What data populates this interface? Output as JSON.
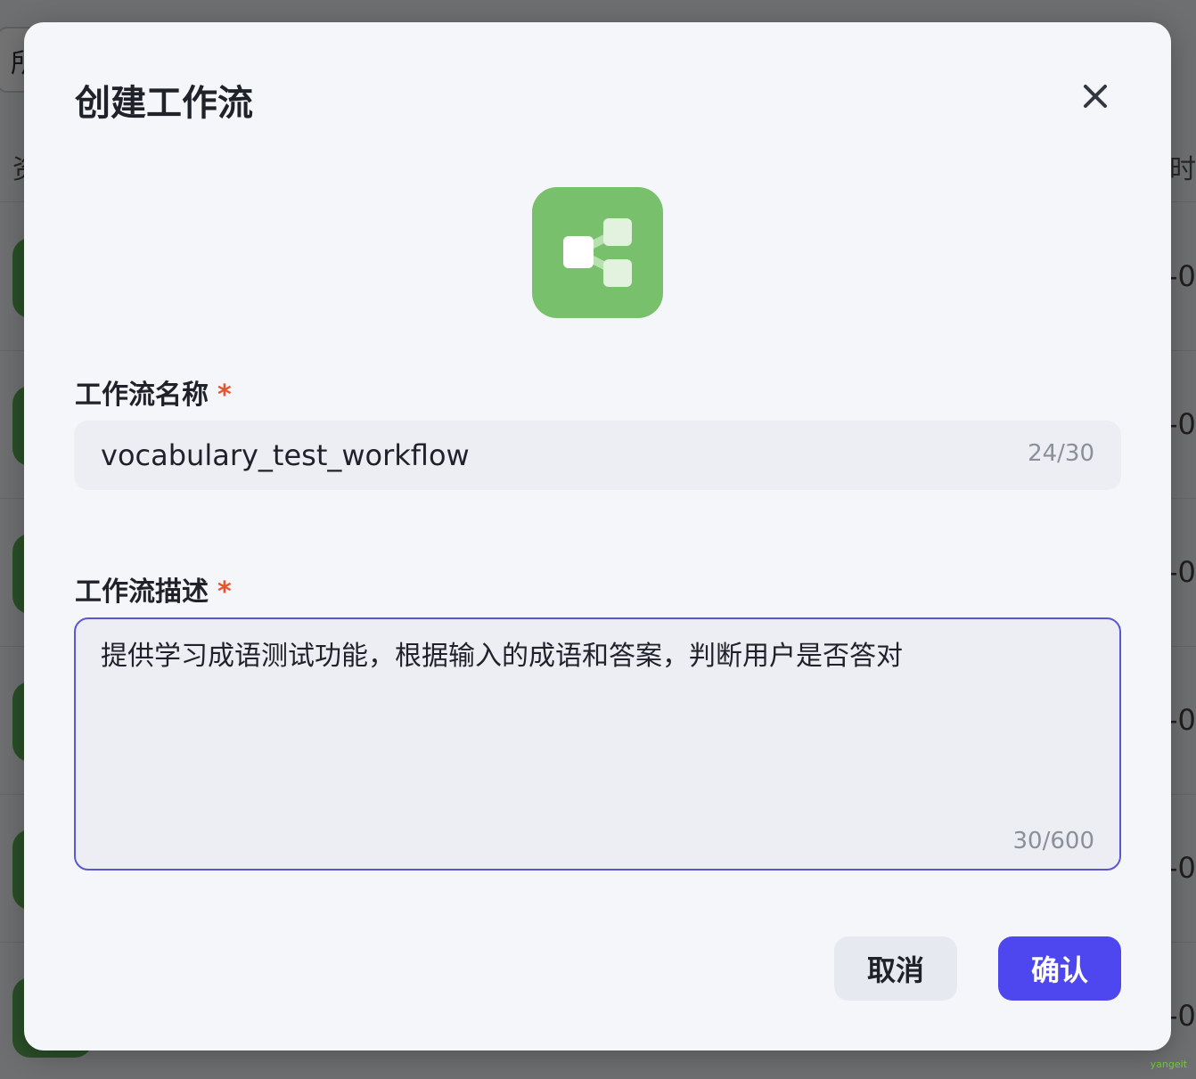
{
  "background": {
    "filter_text": "所",
    "col_left_header": "资",
    "col_right_header": "时间",
    "row_tail_text": "-0",
    "row_count": 6
  },
  "watermark": "yangeit",
  "dialog": {
    "title": "创建工作流",
    "close_icon": "close-icon",
    "workflow_icon": "workflow-share-icon",
    "icon_color": "#78c06b",
    "name_field": {
      "label": "工作流名称",
      "required_mark": "*",
      "value": "vocabulary_test_workflow",
      "counter": "24/30"
    },
    "description_field": {
      "label": "工作流描述",
      "required_mark": "*",
      "value": "提供学习成语测试功能，根据输入的成语和答案，判断用户是否答对",
      "counter": "30/600"
    },
    "cancel_label": "取消",
    "confirm_label": "确认",
    "accent_color": "#4e47f0",
    "required_color": "#e5542d"
  }
}
